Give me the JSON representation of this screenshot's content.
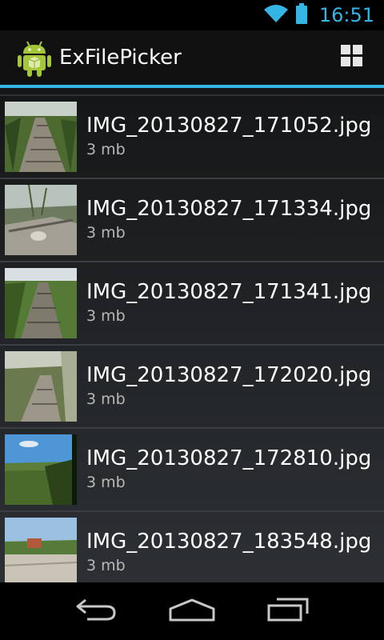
{
  "status_bar": {
    "time": "16:51",
    "icons": [
      "wifi-icon",
      "battery-icon"
    ],
    "accent_color": "#33b5e5"
  },
  "action_bar": {
    "title": "ExFilePicker",
    "app_icon": "android-icon",
    "actions": [
      "grid-view-icon"
    ],
    "accent_color": "#33b5e5"
  },
  "files": [
    {
      "name": "IMG_20130827_171052.jpg",
      "size": "3 mb"
    },
    {
      "name": "IMG_20130827_171334.jpg",
      "size": "3 mb"
    },
    {
      "name": "IMG_20130827_171341.jpg",
      "size": "3 mb"
    },
    {
      "name": "IMG_20130827_172020.jpg",
      "size": "3 mb"
    },
    {
      "name": "IMG_20130827_172810.jpg",
      "size": "3 mb"
    },
    {
      "name": "IMG_20130827_183548.jpg",
      "size": "3 mb"
    }
  ],
  "nav_bar": {
    "icons": [
      "back-icon",
      "home-icon",
      "recent-apps-icon"
    ]
  }
}
